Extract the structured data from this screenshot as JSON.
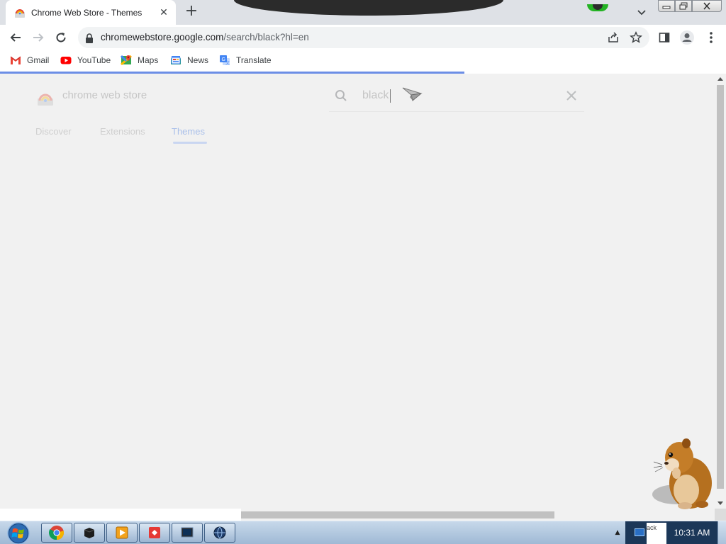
{
  "browser": {
    "tab": {
      "title": "Chrome Web Store - Themes",
      "close": "✕"
    },
    "new_tab": "+",
    "url": {
      "domain": "chromewebstore.google.com",
      "path": "/search/black?hl=en"
    },
    "bookmarks": [
      {
        "label": "Gmail",
        "icon": "gmail-icon"
      },
      {
        "label": "YouTube",
        "icon": "youtube-icon"
      },
      {
        "label": "Maps",
        "icon": "maps-icon"
      },
      {
        "label": "News",
        "icon": "news-icon"
      },
      {
        "label": "Translate",
        "icon": "translate-icon"
      }
    ],
    "page_load_progress": 0.64
  },
  "store": {
    "name": "chrome web store",
    "search_query": "black",
    "tabs": [
      {
        "label": "Discover",
        "active": false
      },
      {
        "label": "Extensions",
        "active": false
      },
      {
        "label": "Themes",
        "active": true
      }
    ]
  },
  "taskbar": {
    "tray_popup_text": "ack",
    "clock": "10:31 AM"
  },
  "colors": {
    "accent": "#6c8ee6",
    "active_tab": "#aac0ea",
    "taskbar": "#b3c9e0"
  }
}
